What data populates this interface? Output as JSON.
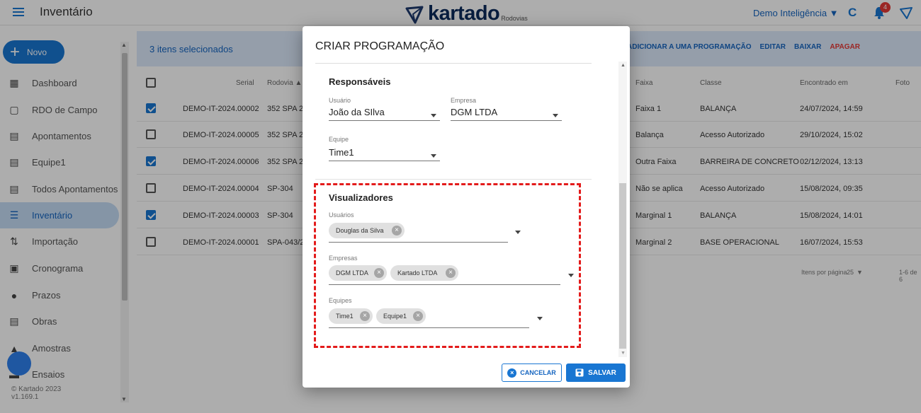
{
  "header": {
    "app_title": "Inventário",
    "logo_text": "kartado",
    "logo_sub": "Rodovias",
    "account": "Demo Inteligência ▼",
    "notification_count": "4"
  },
  "sidebar": {
    "new_label": "Novo",
    "items": [
      {
        "label": "Dashboard",
        "icon": "dashboard-icon"
      },
      {
        "label": "RDO de Campo",
        "icon": "clipboard-icon"
      },
      {
        "label": "Apontamentos",
        "icon": "notes-icon"
      },
      {
        "label": "Equipe1",
        "icon": "notes-icon"
      },
      {
        "label": "Todos Apontamentos",
        "icon": "notes-icon"
      },
      {
        "label": "Inventário",
        "icon": "list-icon"
      },
      {
        "label": "Importação",
        "icon": "import-icon"
      },
      {
        "label": "Cronograma",
        "icon": "calendar-icon"
      },
      {
        "label": "Prazos",
        "icon": "clock-icon"
      },
      {
        "label": "Obras",
        "icon": "clipboard-icon"
      },
      {
        "label": "Amostras",
        "icon": "flask-icon"
      },
      {
        "label": "Ensaios",
        "icon": "lab-icon"
      }
    ],
    "copyright": "© Kartado 2023",
    "version": "v1.169.1"
  },
  "toolbar": {
    "selected_text": "3 itens selecionados",
    "add_to_program": "ADICIONAR A UMA PROGRAMAÇÃO",
    "edit": "EDITAR",
    "download": "BAIXAR",
    "delete": "APAGAR"
  },
  "table": {
    "columns": [
      "Serial",
      "Rodovia ▲",
      "Faixa",
      "Classe",
      "Encontrado em",
      "Foto"
    ],
    "rows": [
      {
        "checked": true,
        "serial": "DEMO-IT-2024.00002",
        "rodovia": "352 SPA 2",
        "faixa": "Faixa 1",
        "classe": "BALANÇA",
        "encontrado": "24/07/2024, 14:59"
      },
      {
        "checked": false,
        "serial": "DEMO-IT-2024.00005",
        "rodovia": "352 SPA 2",
        "faixa": "Balança",
        "classe": "Acesso Autorizado",
        "encontrado": "29/10/2024, 15:02"
      },
      {
        "checked": true,
        "serial": "DEMO-IT-2024.00006",
        "rodovia": "352 SPA 2",
        "faixa": "Outra Faixa",
        "classe": "BARREIRA DE CONCRETO",
        "encontrado": "02/12/2024, 13:13"
      },
      {
        "checked": false,
        "serial": "DEMO-IT-2024.00004",
        "rodovia": "SP-304",
        "faixa": "Não se aplica",
        "classe": "Acesso Autorizado",
        "encontrado": "15/08/2024, 09:35"
      },
      {
        "checked": true,
        "serial": "DEMO-IT-2024.00003",
        "rodovia": "SP-304",
        "faixa": "Marginal 1",
        "classe": "BALANÇA",
        "encontrado": "15/08/2024, 14:01"
      },
      {
        "checked": false,
        "serial": "DEMO-IT-2024.00001",
        "rodovia": "SPA-043/2",
        "faixa": "Marginal 2",
        "classe": "BASE OPERACIONAL",
        "encontrado": "16/07/2024, 15:53"
      }
    ],
    "items_per_page_label": "Itens por página",
    "items_per_page": "25",
    "range": "1-6 de 6"
  },
  "modal": {
    "title": "CRIAR PROGRAMAÇÃO",
    "responsaveis": {
      "title": "Responsáveis",
      "usuario_label": "Usuário",
      "usuario_value": "João da SIlva",
      "empresa_label": "Empresa",
      "empresa_value": "DGM LTDA",
      "equipe_label": "Equipe",
      "equipe_value": "Time1"
    },
    "visualizadores": {
      "title": "Visualizadores",
      "usuarios_label": "Usuários",
      "usuarios": [
        "Douglas da Silva"
      ],
      "empresas_label": "Empresas",
      "empresas": [
        "DGM LTDA",
        "Kartado LTDA"
      ],
      "equipes_label": "Equipes",
      "equipes": [
        "Time1",
        "Equipe1"
      ]
    },
    "cancel_label": "CANCELAR",
    "save_label": "SALVAR"
  },
  "colors": {
    "primary": "#1976d2",
    "highlight_border": "#e31b1b",
    "delete": "#e53935"
  }
}
